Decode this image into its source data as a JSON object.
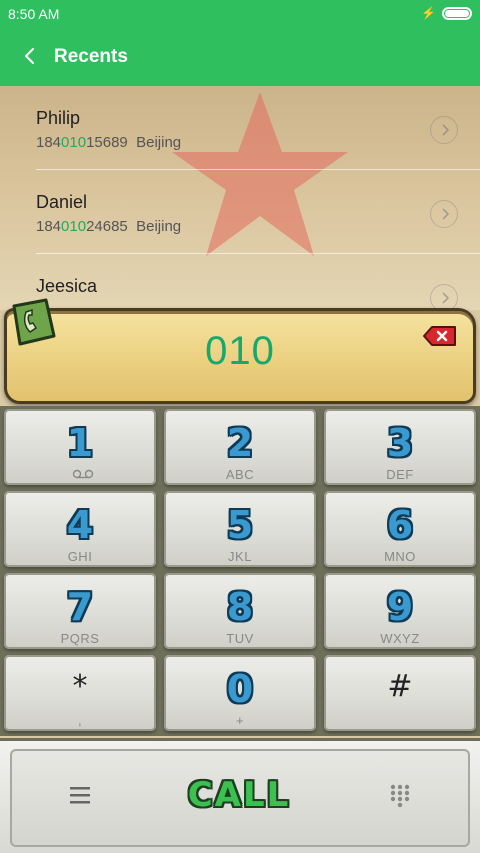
{
  "status_bar": {
    "time": "8:50 AM",
    "battery_level": 1.0
  },
  "app_bar": {
    "title": "Recents",
    "back_icon": "chevron-left-icon"
  },
  "recents": [
    {
      "name": "Philip",
      "number_prefix": "184",
      "number_match": "010",
      "number_suffix": "15689",
      "location": "Beijing"
    },
    {
      "name": "Daniel",
      "number_prefix": "184",
      "number_match": "010",
      "number_suffix": "24685",
      "location": "Beijing"
    },
    {
      "name": "Jeesica",
      "number_prefix": "",
      "number_match": "",
      "number_suffix": "",
      "location": ""
    }
  ],
  "dialer": {
    "input": "010",
    "delete_icon": "backspace-icon"
  },
  "keypad": [
    {
      "digit": "1",
      "letters": ""
    },
    {
      "digit": "2",
      "letters": "ABC"
    },
    {
      "digit": "3",
      "letters": "DEF"
    },
    {
      "digit": "4",
      "letters": "GHI"
    },
    {
      "digit": "5",
      "letters": "JKL"
    },
    {
      "digit": "6",
      "letters": "MNO"
    },
    {
      "digit": "7",
      "letters": "PQRS"
    },
    {
      "digit": "8",
      "letters": "TUV"
    },
    {
      "digit": "9",
      "letters": "WXYZ"
    },
    {
      "digit": "*",
      "letters": ","
    },
    {
      "digit": "0",
      "letters": "+"
    },
    {
      "digit": "#",
      "letters": ""
    }
  ],
  "bottom_bar": {
    "call_label": "CALL",
    "menu_icon": "menu-icon",
    "dialpad_icon": "dialpad-icon"
  },
  "colors": {
    "accent": "#2fbf5f",
    "match_highlight": "#22a95c",
    "digit_blue": "#3a9ad0",
    "call_green": "#3cc04f"
  }
}
